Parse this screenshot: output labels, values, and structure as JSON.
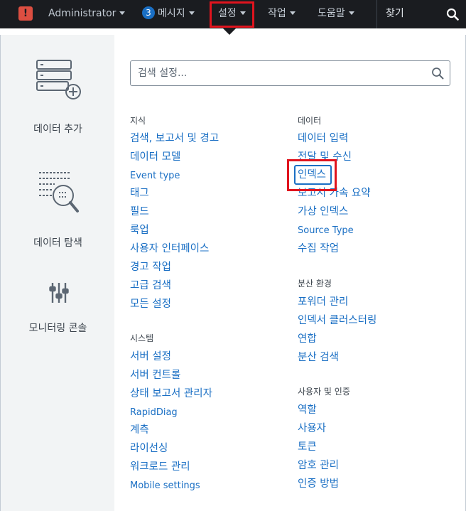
{
  "topbar": {
    "alert_icon": "!",
    "user": "Administrator",
    "messages_count": "3",
    "messages": "메시지",
    "settings": "설정",
    "activity": "작업",
    "help": "도움말",
    "find": "찾기"
  },
  "sidebar": {
    "items": [
      {
        "label": "데이터 추가",
        "icon": "add-data-icon"
      },
      {
        "label": "데이터 탐색",
        "icon": "explore-data-icon"
      },
      {
        "label": "모니터링 콘솔",
        "icon": "monitoring-console-icon"
      }
    ]
  },
  "search": {
    "placeholder": "검색 설정..."
  },
  "left_column": {
    "knowledge": {
      "title": "지식",
      "links": [
        "검색, 보고서 및 경고",
        "데이터 모델",
        "Event type",
        "태그",
        "필드",
        "룩업",
        "사용자 인터페이스",
        "경고 작업",
        "고급 검색",
        "모든 설정"
      ]
    },
    "system": {
      "title": "시스템",
      "links": [
        "서버 설정",
        "서버 컨트롤",
        "상태 보고서 관리자",
        "RapidDiag",
        "계측",
        "라이선싱",
        "워크로드 관리",
        "Mobile settings"
      ]
    }
  },
  "right_column": {
    "data": {
      "title": "데이터",
      "links": [
        "데이터 입력",
        "전달 및 수신",
        "인덱스",
        "보고서 가속 요약",
        "가상 인덱스",
        "Source Type",
        "수집 작업"
      ]
    },
    "distributed": {
      "title": "분산 환경",
      "links": [
        "포워더 관리",
        "인덱서 클러스터링",
        "연합",
        "분산 검색"
      ]
    },
    "users_auth": {
      "title": "사용자 및 인증",
      "links": [
        "역할",
        "사용자",
        "토큰",
        "암호 관리",
        "인증 방법"
      ]
    }
  },
  "colors": {
    "link": "#1a6fc4",
    "topbar": "#1a1c20",
    "highlight": "#e0141e"
  }
}
